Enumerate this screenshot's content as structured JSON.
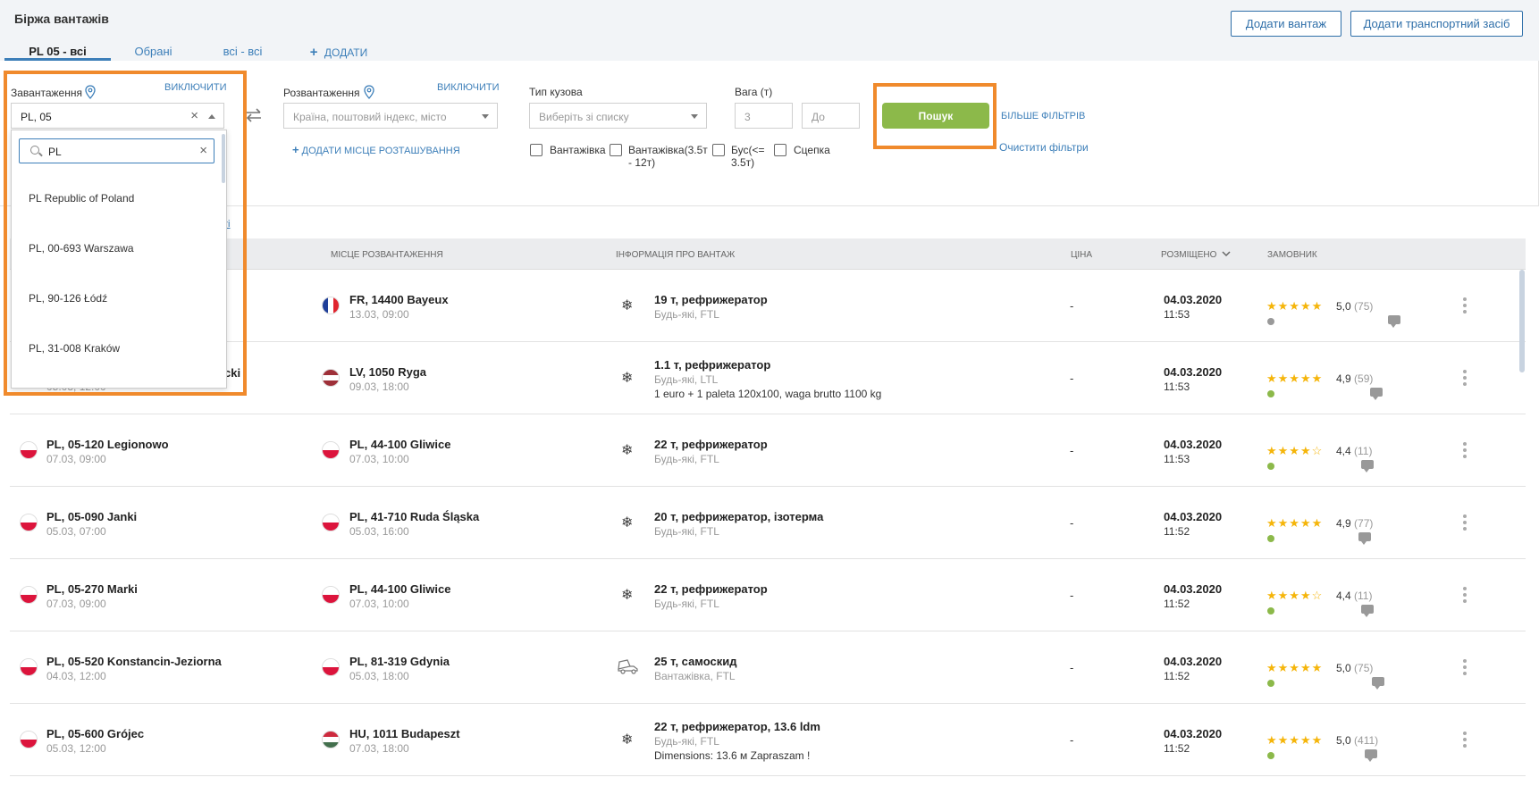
{
  "header": {
    "title": "Біржа вантажів",
    "add_cargo": "Додати вантаж",
    "add_vehicle": "Додати транспортний засіб"
  },
  "tabs": [
    {
      "label": "PL 05 - всі",
      "active": true
    },
    {
      "label": "Обрані"
    },
    {
      "label": "всі - всі"
    },
    {
      "label": "ДОДАТИ",
      "icon": "plus-icon"
    }
  ],
  "filters": {
    "loading_label": "Завантаження",
    "loading_exclude": "ВИКЛЮЧИТИ",
    "loading_value": "PL, 05",
    "unloading_label": "Розвантаження",
    "unloading_exclude": "ВИКЛЮЧИТИ",
    "unloading_placeholder": "Країна, поштовий індекс, місто",
    "add_location": "ДОДАТИ МІСЦЕ РОЗТАШУВАННЯ",
    "body_type_label": "Тип кузова",
    "body_type_placeholder": "Виберіть зі списку",
    "weight_label": "Вага (т)",
    "weight_from": "3",
    "weight_to": "До",
    "checkboxes": [
      "Вантажівка",
      "Вантажівка(3.5т - 12т)",
      "Бус(<= 3.5т)",
      "Сцепка"
    ],
    "search": "Пошук",
    "more_filters": "БІЛЬШЕ ФІЛЬТРІВ",
    "clear_filters": "Очистити фільтри",
    "partial_link": "ті"
  },
  "dropdown": {
    "query": "PL",
    "items": [
      "PL Republic of Poland",
      "PL, 00-693 Warszawa",
      "PL, 90-126 Łódź",
      "PL, 31-008 Kraków"
    ]
  },
  "table": {
    "headers": {
      "unloading": "МІСЦЕ РОЗВАНТАЖЕННЯ",
      "cargo": "ІНФОРМАЦІЯ ПРО ВАНТАЖ",
      "price": "ЦІНА",
      "posted": "РОЗМІЩЕНО",
      "customer": "ЗАМОВНИК"
    },
    "rows": [
      {
        "from_place": "",
        "from_date": "",
        "from_flag": "",
        "to_place": "FR, 14400 Bayeux",
        "to_date": "13.03, 09:00",
        "to_flag": "fr",
        "cargo_icon": "snowflake-icon",
        "cargo_main": "19 т, рефрижератор",
        "cargo_sub": "Будь-які, FTL",
        "cargo_extra": "",
        "price": "-",
        "date": "04.03.2020",
        "time": "11:53",
        "stars": "★★★★★",
        "score": "5,0",
        "count": "(75)",
        "status": "#999999"
      },
      {
        "from_place": "cki",
        "from_date": "05.03, 12:00",
        "from_flag": "",
        "to_place": "LV, 1050 Ryga",
        "to_date": "09.03, 18:00",
        "to_flag": "lv",
        "cargo_icon": "snowflake-icon",
        "cargo_main": "1.1 т, рефрижератор",
        "cargo_sub": "Будь-які, LTL",
        "cargo_extra": "1 euro + 1 paleta 120x100, waga brutto 1100 kg",
        "price": "-",
        "date": "04.03.2020",
        "time": "11:53",
        "stars": "★★★★★",
        "score": "4,9",
        "count": "(59)",
        "status": "#8cb94a"
      },
      {
        "from_place": "PL, 05-120 Legionowo",
        "from_date": "07.03, 09:00",
        "from_flag": "pl",
        "to_place": "PL, 44-100 Gliwice",
        "to_date": "07.03, 10:00",
        "to_flag": "pl",
        "cargo_icon": "snowflake-icon",
        "cargo_main": "22 т, рефрижератор",
        "cargo_sub": "Будь-які, FTL",
        "cargo_extra": "",
        "price": "-",
        "date": "04.03.2020",
        "time": "11:53",
        "stars": "★★★★☆",
        "score": "4,4",
        "count": "(11)",
        "status": "#8cb94a"
      },
      {
        "from_place": "PL, 05-090 Janki",
        "from_date": "05.03, 07:00",
        "from_flag": "pl",
        "to_place": "PL, 41-710 Ruda Śląska",
        "to_date": "05.03, 16:00",
        "to_flag": "pl",
        "cargo_icon": "snowflake-icon",
        "cargo_main": "20 т, рефрижератор, ізотерма",
        "cargo_sub": "Будь-які, FTL",
        "cargo_extra": "",
        "price": "-",
        "date": "04.03.2020",
        "time": "11:52",
        "stars": "★★★★★",
        "score": "4,9",
        "count": "(77)",
        "status": "#8cb94a"
      },
      {
        "from_place": "PL, 05-270 Marki",
        "from_date": "07.03, 09:00",
        "from_flag": "pl",
        "to_place": "PL, 44-100 Gliwice",
        "to_date": "07.03, 10:00",
        "to_flag": "pl",
        "cargo_icon": "snowflake-icon",
        "cargo_main": "22 т, рефрижератор",
        "cargo_sub": "Будь-які, FTL",
        "cargo_extra": "",
        "price": "-",
        "date": "04.03.2020",
        "time": "11:52",
        "stars": "★★★★☆",
        "score": "4,4",
        "count": "(11)",
        "status": "#8cb94a"
      },
      {
        "from_place": "PL, 05-520 Konstancin-Jeziorna",
        "from_date": "04.03, 12:00",
        "from_flag": "pl",
        "to_place": "PL, 81-319 Gdynia",
        "to_date": "05.03, 18:00",
        "to_flag": "pl",
        "cargo_icon": "dump-truck-icon",
        "cargo_main": "25 т, самоскид",
        "cargo_sub": "Вантажівка, FTL",
        "cargo_extra": "",
        "price": "-",
        "date": "04.03.2020",
        "time": "11:52",
        "stars": "★★★★★",
        "score": "5,0",
        "count": "(75)",
        "status": "#8cb94a"
      },
      {
        "from_place": "PL, 05-600 Grójec",
        "from_date": "05.03, 12:00",
        "from_flag": "pl",
        "to_place": "HU, 1011 Budapeszt",
        "to_date": "07.03, 18:00",
        "to_flag": "hu",
        "cargo_icon": "snowflake-icon",
        "cargo_main": "22 т, рефрижератор, 13.6 ldm",
        "cargo_sub": "Будь-які, FTL",
        "cargo_extra": "Dimensions: 13.6 м Zapraszam !",
        "price": "-",
        "date": "04.03.2020",
        "time": "11:52",
        "stars": "★★★★★",
        "score": "5,0",
        "count": "(411)",
        "status": "#8cb94a"
      }
    ]
  },
  "colors": {
    "accent": "#3d7fb9",
    "search_button": "#8cb94a",
    "highlight": "#f08a2c",
    "stars": "#f5b50a"
  }
}
